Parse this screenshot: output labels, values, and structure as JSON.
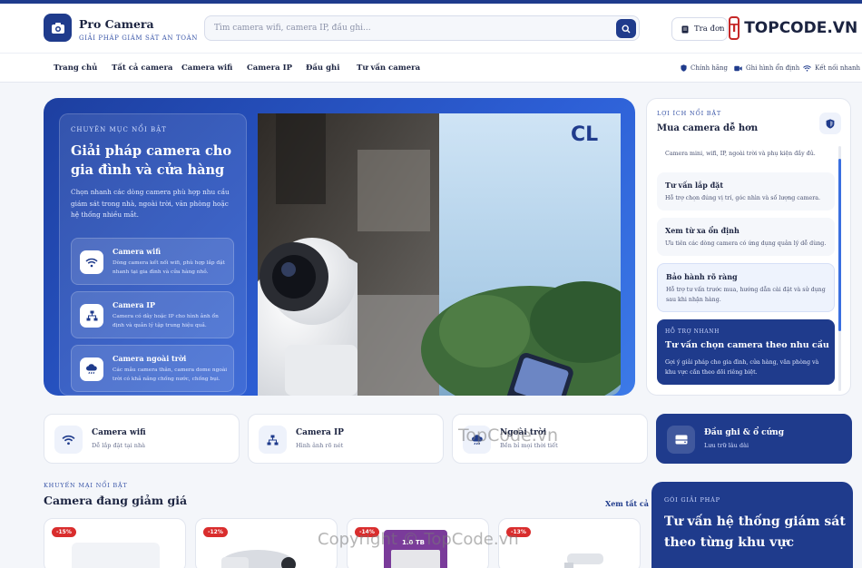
{
  "header": {
    "brand": "Pro Camera",
    "tagline": "GIẢI PHÁP GIÁM SÁT AN TOÀN",
    "search_placeholder": "Tìm camera wifi, camera IP, đầu ghi...",
    "order_label": "Tra đơn"
  },
  "watermark": {
    "badge": "T",
    "top_text": "TOPCODE.VN",
    "center_text": "TopCode.vn",
    "copyright": "Copyright © TopCode.vn"
  },
  "nav": {
    "items": [
      "Trang chủ",
      "Tất cả camera",
      "Camera wifi",
      "Camera IP",
      "Đầu ghi",
      "Tư vấn camera"
    ],
    "features": [
      "Chính hãng",
      "Ghi hình ổn định",
      "Kết nối nhanh"
    ]
  },
  "hero": {
    "kicker": "CHUYÊN MỤC NỔI BẬT",
    "title": "Giải pháp camera cho gia đình và cửa hàng",
    "description": "Chọn nhanh các dòng camera phù hợp nhu cầu giám sát trong nhà, ngoài trời, văn phòng hoặc hệ thống nhiều mắt.",
    "categories": [
      {
        "title": "Camera wifi",
        "desc": "Dòng camera kết nối wifi, phù hợp lắp đặt nhanh tại gia đình và cửa hàng nhỏ."
      },
      {
        "title": "Camera IP",
        "desc": "Camera có dây hoặc IP cho hình ảnh ổn định và quản lý tập trung hiệu quả."
      },
      {
        "title": "Camera ngoài trời",
        "desc": "Các mẫu camera thân, camera dome ngoài trời có khả năng chống nước, chống bụi."
      }
    ],
    "image_brand": "CL"
  },
  "side_panel": {
    "kicker": "LỢI ÍCH NỔI BẬT",
    "title": "Mua camera dễ hơn",
    "partial_desc": "Camera mini, wifi, IP, ngoài trời và phụ kiện đầy đủ.",
    "items": [
      {
        "title": "Tư vấn lắp đặt",
        "desc": "Hỗ trợ chọn đúng vị trí, góc nhìn và số lượng camera."
      },
      {
        "title": "Xem từ xa ổn định",
        "desc": "Ưu tiên các dòng camera có ứng dụng quản lý dễ dùng."
      },
      {
        "title": "Bảo hành rõ ràng",
        "desc": "Hỗ trợ tư vấn trước mua, hướng dẫn cài đặt và sử dụng sau khi nhận hàng."
      }
    ],
    "cta": {
      "kicker": "HỖ TRỢ NHANH",
      "title": "Tư vấn chọn camera theo nhu cầu",
      "desc": "Gợi ý giải pháp cho gia đình, cửa hàng, văn phòng và khu vực cần theo dõi riêng biệt."
    }
  },
  "category_row": [
    {
      "title": "Camera wifi",
      "sub": "Dễ lắp đặt tại nhà"
    },
    {
      "title": "Camera IP",
      "sub": "Hình ảnh rõ nét"
    },
    {
      "title": "Ngoài trời",
      "sub": "Bền bỉ mọi thời tiết"
    },
    {
      "title": "Đầu ghi & ổ cứng",
      "sub": "Lưu trữ lâu dài"
    }
  ],
  "promo": {
    "kicker": "KHUYẾN MẠI NỔI BẬT",
    "title": "Camera đang giảm giá",
    "see_all": "Xem tất cả",
    "products": [
      {
        "discount": "-15%"
      },
      {
        "discount": "-12%"
      },
      {
        "discount": "-14%",
        "label": "1.0 TB"
      },
      {
        "discount": "-13%"
      }
    ]
  },
  "solution": {
    "kicker": "GÓI GIẢI PHÁP",
    "title": "Tư vấn hệ thống giám sát theo từng khu vực"
  }
}
